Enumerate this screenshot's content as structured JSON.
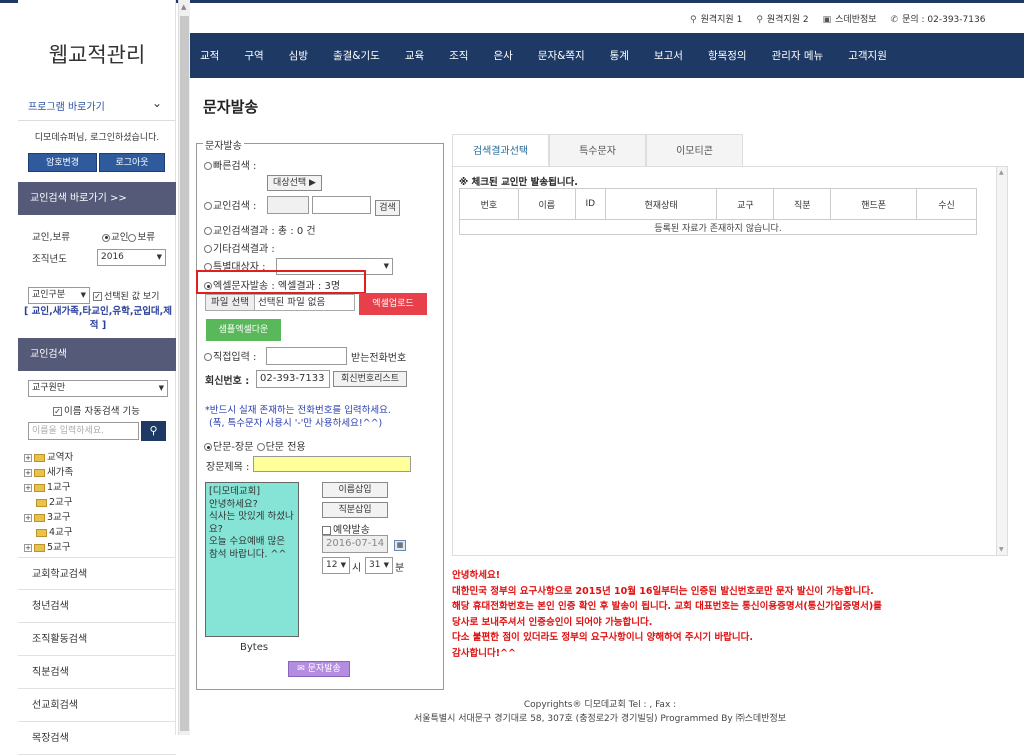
{
  "top_links": [
    "원격지원 1",
    "원격지원 2",
    "스데반정보",
    "문의 : 02-393-7136"
  ],
  "app_title": "웹교적관리",
  "nav": [
    "교적",
    "구역",
    "심방",
    "출결&기도",
    "교육",
    "조직",
    "은사",
    "문자&쪽지",
    "통계",
    "보고서",
    "항목정의",
    "관리자 메뉴",
    "고객지원"
  ],
  "sidebar": {
    "quick_title": "프로그램 바로가기",
    "welcome": "디모데슈퍼님, 로그인하셨습니다.",
    "btn_password": "암호변경",
    "btn_logout": "로그아웃",
    "search_shortcut": "교인검색 바로가기 >>",
    "label_type": "교인,보류",
    "opt_member": "교인",
    "opt_hold": "보류",
    "label_year": "조직년도",
    "year_value": "2016",
    "category_value": "교인구분",
    "show_selected": "선택된 값 보기",
    "category_list": "[ 교인,새가족,타교인,유학,군입대,제적 ]",
    "member_search": "교인검색",
    "district_value": "교구원만",
    "auto_search": "이름 자동검색 기능",
    "name_placeholder": "이름을 입력하세요.",
    "tree": [
      "교역자",
      "새가족",
      "1교구",
      "2교구",
      "3교구",
      "4교구",
      "5교구"
    ],
    "links": [
      "교회학교검색",
      "청년검색",
      "조직활동검색",
      "직분검색",
      "선교회검색",
      "목장검색"
    ]
  },
  "page_title": "문자발송",
  "form": {
    "legend": "문자발송",
    "quick_search": "빠른검색 :",
    "target_select": "대상선택 ▶",
    "member_search": "교인검색 :",
    "search_btn": "검색",
    "member_result": "교인검색결과 : 총 : 0 건",
    "other_result": "기타검색결과 :",
    "special_target": "특별대상자 :",
    "excel_send": "엑셀문자발송 : 엑셀결과 : 3명",
    "file_select": "파일 선택",
    "no_file": "선택된 파일 없음",
    "excel_upload": "엑셀업로드",
    "sample_download": "샘플엑셀다운",
    "direct_input": "직접입력 :",
    "receiver_label": "받는전화번호",
    "reply_label": "회신번호 :",
    "reply_value": "02-393-7133",
    "reply_list": "회신번호리스트",
    "warning_1": "*반드시 실재 존재하는 전화번호를 입력하세요.",
    "warning_2": "(폭, 특수문자 사용시 '-'만 사용하세요!^^)",
    "sms_long": "단문-장문",
    "sms_only": "단문 전용",
    "subject_label": "장문제목 :",
    "message": "[디모데교회]\n안녕하세요?\n식사는 맛있게 하셨나요?\n오늘 수요예배 많은 참석 바랍니다. ^^",
    "insert_name": "이름삽입",
    "insert_role": "직분삽입",
    "reserve": "예약발송",
    "date_value": "2016-07-14",
    "hour_value": "12",
    "hour_unit": "시",
    "min_value": "31",
    "min_unit": "분",
    "bytes_label": "Bytes",
    "send_btn": "문자발송"
  },
  "tabs": [
    "검색결과선택",
    "특수문자",
    "이모티콘"
  ],
  "result": {
    "note": "※ 체크된 교인만 발송됩니다.",
    "columns": [
      "번호",
      "이름",
      "ID",
      "현재상태",
      "교구",
      "직분",
      "핸드폰",
      "수신"
    ],
    "empty": "등록된 자료가 존재하지 않습니다."
  },
  "notice": [
    "안녕하세요!",
    "대한민국 정부의 요구사항으로 2015년 10월 16일부터는 인증된 발신번호로만 문자 발신이 가능합니다.",
    "해당 휴대전화번호는 본인 인증 확인 후 발송이 됩니다. 교회 대표번호는 통신이용증명서(통신가입증명서)를",
    "당사로 보내주셔서 인증승인이 되어야 가능합니다.",
    "다소 불편한 점이 있더라도 정부의 요구사항이니 양해하여 주시기 바랍니다.",
    "감사합니다!^^"
  ],
  "footer": {
    "line1": "Copyrights® 디모데교회 Tel : , Fax :",
    "line2": "서울특별시 서대문구 경기대로 58, 307호 (충정로2가 경기빌딩) Programmed By ㈜스데반정보"
  }
}
